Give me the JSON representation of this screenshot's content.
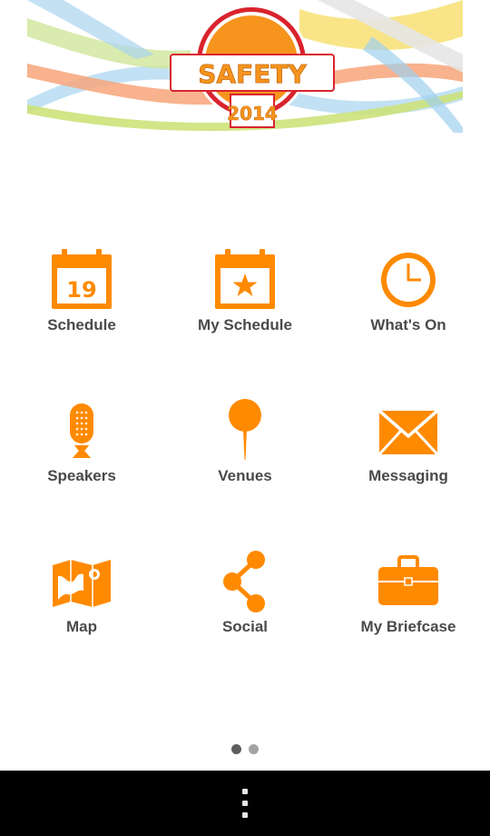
{
  "banner": {
    "logo_word": "SAFETY",
    "logo_year": "2014"
  },
  "colors": {
    "accent": "#ff8a00",
    "label": "#4a4a4a",
    "logo_ring": "#d9232e",
    "nav_bar": "#000000"
  },
  "menu": {
    "items": [
      {
        "label": "Schedule",
        "icon": "calendar-icon",
        "date": "19"
      },
      {
        "label": "My Schedule",
        "icon": "calendar-star-icon"
      },
      {
        "label": "What's On",
        "icon": "clock-icon"
      },
      {
        "label": "Speakers",
        "icon": "microphone-icon"
      },
      {
        "label": "Venues",
        "icon": "map-pin-icon"
      },
      {
        "label": "Messaging",
        "icon": "envelope-icon"
      },
      {
        "label": "Map",
        "icon": "map-icon"
      },
      {
        "label": "Social",
        "icon": "share-icon"
      },
      {
        "label": "My Briefcase",
        "icon": "briefcase-icon"
      }
    ]
  },
  "pager": {
    "pages": 2,
    "current": 1
  },
  "navbar": {
    "icon": "overflow-menu-icon"
  }
}
